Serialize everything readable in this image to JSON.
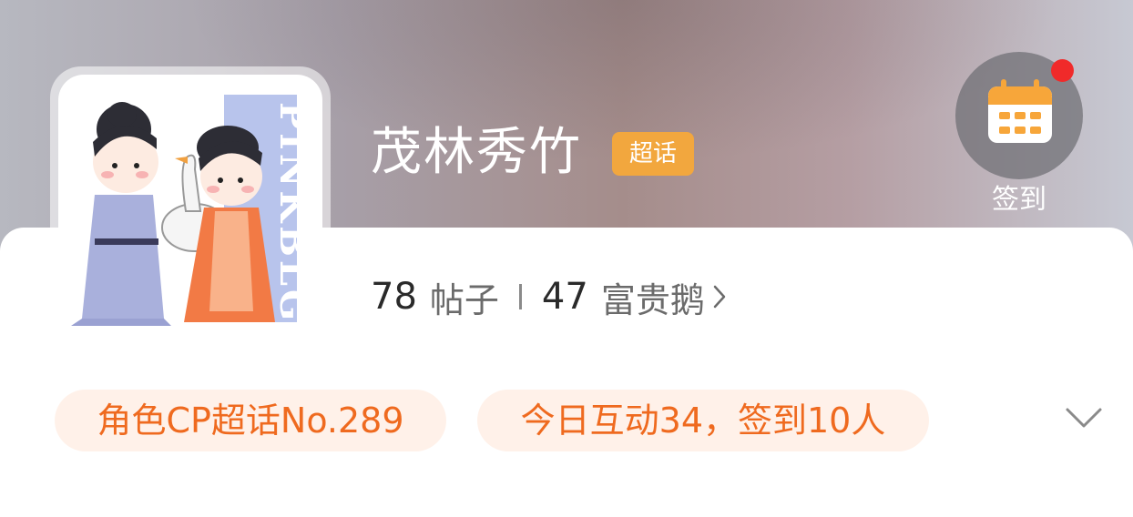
{
  "header": {
    "title": "茂林秀竹",
    "badge": "超话",
    "checkin": {
      "label": "签到",
      "icon": "calendar-icon",
      "notification": "red-dot"
    }
  },
  "avatar": {
    "description": "illustration",
    "text": "PINKBLG"
  },
  "stats": {
    "posts_count": "78",
    "posts_label": "帖子",
    "fans_count": "47",
    "fans_label": "富贵鹅",
    "chevron": "chevron-right-icon"
  },
  "pills": {
    "rank": "角色CP超话No.289",
    "activity": "今日互动34，签到10人"
  },
  "expand_icon": "chevron-down-icon",
  "colors": {
    "accent": "#ef6a1f",
    "pill_bg": "#fff1e9",
    "badge": "#f2a73e",
    "calendar": "#f7a63a",
    "dot": "#f02a2a"
  }
}
